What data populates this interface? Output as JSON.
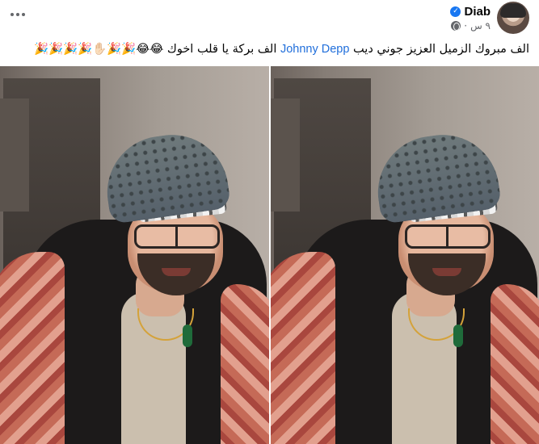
{
  "post": {
    "author": "Diab",
    "time": "٩ س",
    "separator": "·",
    "caption": {
      "text_before": "الف مبروك الزميل العزيز جوني ديب",
      "mention": "Johnny Depp",
      "text_after": "الف بركة يا قلب اخوك",
      "emojis": "😂😂🎉🎉✋🏻🎉🎉🎉🎉"
    }
  },
  "icons": {
    "menu": "more-options-icon",
    "verified": "verified-badge-icon",
    "audience": "globe-icon"
  },
  "colors": {
    "link": "#216fdb",
    "verified": "#1877f2",
    "meta_text": "#65676b"
  }
}
